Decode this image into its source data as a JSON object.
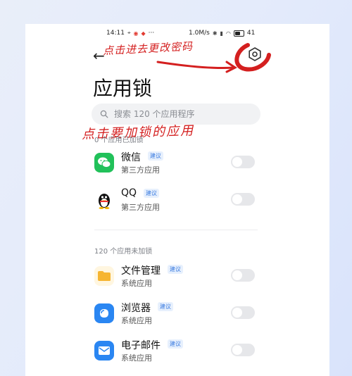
{
  "statusbar": {
    "time": "14:11",
    "dots": "···",
    "speed": "1.0M/s",
    "battery": "41"
  },
  "annotations": {
    "top": "点击进去更改密码",
    "middle": "点击要加锁的应用"
  },
  "header": {
    "back_icon": "back-arrow-icon",
    "settings_icon": "gear-icon",
    "title": "应用锁"
  },
  "search": {
    "placeholder": "搜索 120 个应用程序"
  },
  "locked_section": {
    "label": "0 个应用已加锁",
    "apps": [
      {
        "name": "微信",
        "badge": "建议",
        "sub": "第三方应用",
        "icon": "wechat-icon",
        "color": "#21c15a"
      },
      {
        "name": "QQ",
        "badge": "建议",
        "sub": "第三方应用",
        "icon": "qq-penguin-icon",
        "color": "#111111"
      }
    ]
  },
  "unlocked_section": {
    "label": "120 个应用未加锁",
    "apps": [
      {
        "name": "文件管理",
        "badge": "建议",
        "sub": "系统应用",
        "icon": "folder-icon",
        "color": "#f6b532"
      },
      {
        "name": "浏览器",
        "badge": "建议",
        "sub": "系统应用",
        "icon": "browser-icon",
        "color": "#2a86f2"
      },
      {
        "name": "电子邮件",
        "badge": "建议",
        "sub": "系统应用",
        "icon": "mail-icon",
        "color": "#2a86f2"
      }
    ]
  },
  "colors": {
    "annotation": "#d41f1f",
    "badge": "#3a7be0"
  }
}
